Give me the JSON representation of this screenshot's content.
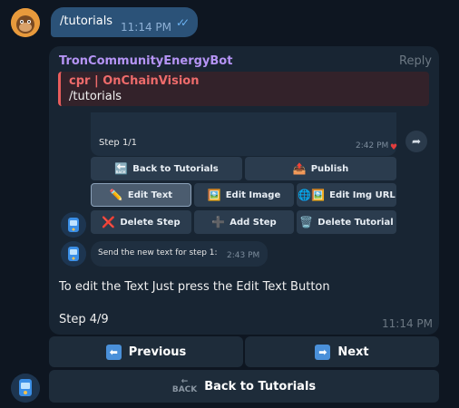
{
  "outgoing": {
    "text": "/tutorials",
    "time": "11:14 PM",
    "status_icon": "double-check-icon"
  },
  "bot_message": {
    "sender": "TronCommunityEnergyBot",
    "reply_label": "Reply",
    "quote": {
      "title": "cpr | OnChainVision",
      "text": "/tutorials"
    },
    "screenshot": {
      "step": "Step 1/1",
      "time": "2:42 PM",
      "reaction": "heart-icon",
      "buttons": [
        {
          "label": "Back to Tutorials",
          "icon": "🔙"
        },
        {
          "label": "Publish",
          "icon": "📤"
        },
        {
          "label": "Edit Text",
          "icon": "✏️"
        },
        {
          "label": "Edit Image",
          "icon": "🖼️"
        },
        {
          "label": "Edit Img URL",
          "icon": "🌐🖼️"
        },
        {
          "label": "Delete Step",
          "icon": "❌"
        },
        {
          "label": "Add Step",
          "icon": "➕"
        },
        {
          "label": "Delete Tutorial",
          "icon": "🗑️"
        }
      ],
      "reply_text": "Send the new text for step 1:",
      "reply_time": "2:43 PM"
    },
    "body_line1": "To edit the Text Just press the Edit Text Button",
    "body_line2": "Step 4/9",
    "time": "11:14 PM"
  },
  "keyboard": {
    "previous": "Previous",
    "next": "Next",
    "back": "Back to Tutorials",
    "back_icon_text": "BACK"
  },
  "colors": {
    "background": "#0e1621",
    "outgoing_bubble": "#2b5278",
    "incoming_bubble": "#182533",
    "sender_name": "#b594f5",
    "quote_accent": "#e85d5d",
    "keyboard_icon": "#4a90d9"
  }
}
